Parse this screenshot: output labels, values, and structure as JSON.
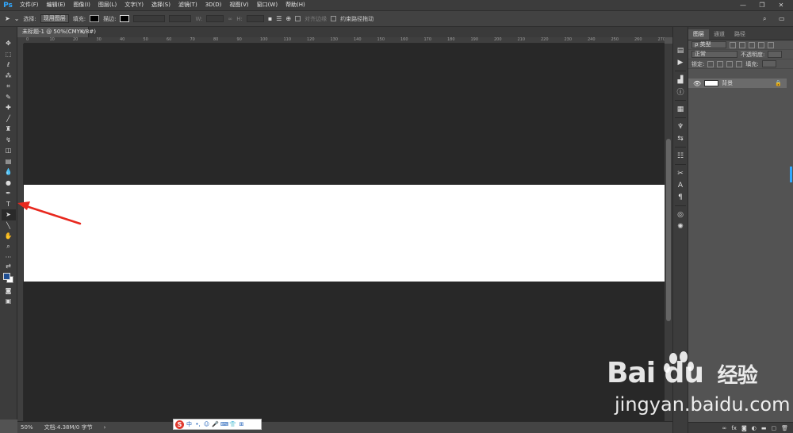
{
  "app": {
    "logo": "Ps"
  },
  "menu": [
    "文件(F)",
    "编辑(E)",
    "图像(I)",
    "图层(L)",
    "文字(Y)",
    "选择(S)",
    "滤镜(T)",
    "3D(D)",
    "视图(V)",
    "窗口(W)",
    "帮助(H)"
  ],
  "window_controls": {
    "minimize": "—",
    "restore": "❐",
    "close": "✕"
  },
  "options": {
    "select_label": "选择:",
    "select_value": "现用图层",
    "fill_label": "填充:",
    "stroke_label": "描边:",
    "align_edges_label": "对齐边缘",
    "constrain_label": "约束路径拖动"
  },
  "document_tab": {
    "title": "未标题-1 @ 50%(CMYK/8#)",
    "close": "×"
  },
  "ruler_top_labels": [
    "0",
    "10",
    "20",
    "30",
    "40",
    "50",
    "60",
    "70",
    "80",
    "90",
    "100",
    "110",
    "120",
    "130",
    "140",
    "150",
    "160",
    "170",
    "180",
    "190",
    "200",
    "210",
    "220",
    "230",
    "240",
    "250",
    "260",
    "270"
  ],
  "statusbar": {
    "zoom": "50%",
    "doc": "文档:4.38M/0 字节",
    "arrow": "›"
  },
  "ime": {
    "logo": "S",
    "items": [
      "中",
      "•,",
      "☺",
      "🎤",
      "⌨",
      "👕",
      "⊞"
    ]
  },
  "layers_panel": {
    "tabs": [
      "图层",
      "通道",
      "路径"
    ],
    "kind_label": "ρ 类型",
    "blend_mode": "正常",
    "opacity_label": "不透明度:",
    "lock_label": "锁定:",
    "fill_label": "填充:",
    "layer_name": "背景"
  },
  "watermark": {
    "brand": "Bai  du",
    "cn": "经验",
    "url": "jingyan.baidu.com"
  },
  "colors": {
    "foreground": "#1f4f93",
    "background": "#ffffff",
    "annotation": "#e8281e"
  }
}
